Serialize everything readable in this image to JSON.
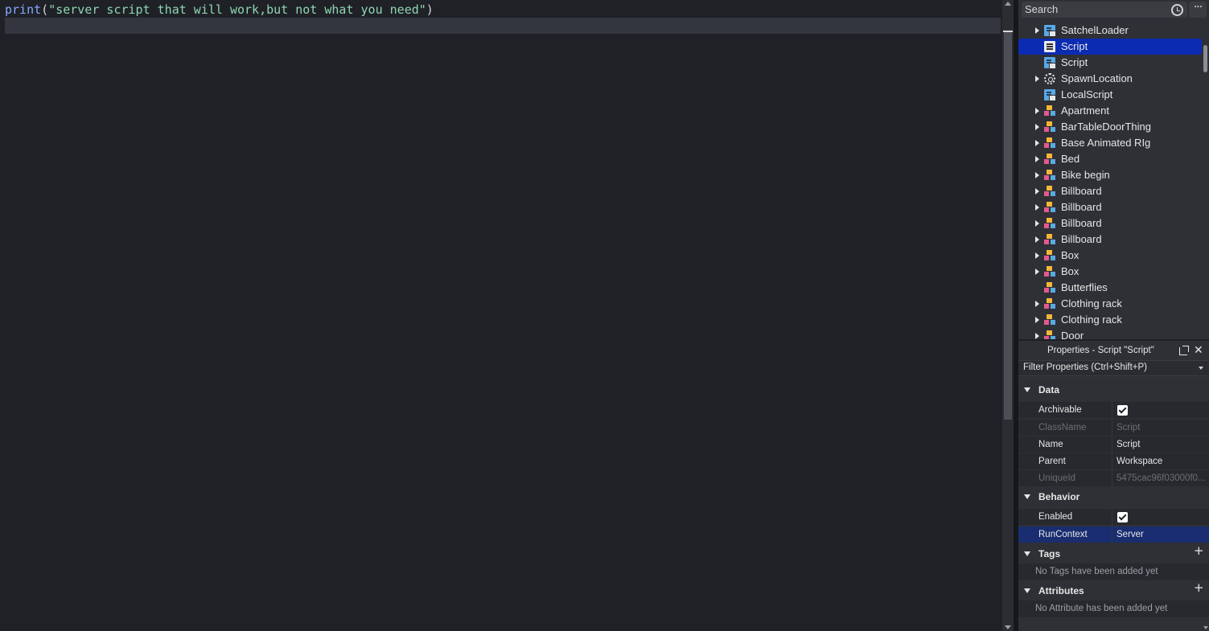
{
  "editor": {
    "line1": {
      "fn": "print",
      "open": "(",
      "string": "\"server script that will work,but not what you need\"",
      "close": ")"
    }
  },
  "explorer": {
    "search_placeholder": "Search",
    "more_label": "···",
    "items": [
      {
        "label": "SatchelLoader",
        "icon": "local-script-icon",
        "expandable": true,
        "selected": false
      },
      {
        "label": "Script",
        "icon": "script-icon",
        "expandable": false,
        "selected": true
      },
      {
        "label": "Script",
        "icon": "local-script-icon",
        "expandable": false,
        "selected": false
      },
      {
        "label": "SpawnLocation",
        "icon": "gear-icon",
        "expandable": true,
        "selected": false
      },
      {
        "label": "LocalScript",
        "icon": "local-script-icon",
        "expandable": false,
        "selected": false
      },
      {
        "label": "Apartment",
        "icon": "model-icon",
        "expandable": true,
        "selected": false
      },
      {
        "label": "BarTableDoorThing",
        "icon": "model-icon",
        "expandable": true,
        "selected": false
      },
      {
        "label": "Base Animated RIg",
        "icon": "model-icon",
        "expandable": true,
        "selected": false
      },
      {
        "label": "Bed",
        "icon": "model-icon",
        "expandable": true,
        "selected": false
      },
      {
        "label": "Bike begin",
        "icon": "model-icon",
        "expandable": true,
        "selected": false
      },
      {
        "label": "Billboard",
        "icon": "model-icon",
        "expandable": true,
        "selected": false
      },
      {
        "label": "Billboard",
        "icon": "model-icon",
        "expandable": true,
        "selected": false
      },
      {
        "label": "Billboard",
        "icon": "model-icon",
        "expandable": true,
        "selected": false
      },
      {
        "label": "Billboard",
        "icon": "model-icon",
        "expandable": true,
        "selected": false
      },
      {
        "label": "Box",
        "icon": "model-icon",
        "expandable": true,
        "selected": false
      },
      {
        "label": "Box",
        "icon": "model-icon",
        "expandable": true,
        "selected": false
      },
      {
        "label": "Butterflies",
        "icon": "model-icon",
        "expandable": false,
        "selected": false
      },
      {
        "label": "Clothing rack",
        "icon": "model-icon",
        "expandable": true,
        "selected": false
      },
      {
        "label": "Clothing rack",
        "icon": "model-icon",
        "expandable": true,
        "selected": false
      },
      {
        "label": "Door",
        "icon": "model-icon",
        "expandable": true,
        "selected": false
      }
    ]
  },
  "properties": {
    "title": "Properties - Script \"Script\"",
    "close_label": "✕",
    "filter_placeholder": "Filter Properties (Ctrl+Shift+P)",
    "data_section": "Data",
    "archivable": "Archivable",
    "classname": "ClassName",
    "classname_value": "Script",
    "name": "Name",
    "name_value": "Script",
    "parent": "Parent",
    "parent_value": "Workspace",
    "uniqueid": "UniqueId",
    "uniqueid_value": "5475cac96f03000f0...",
    "behavior_section": "Behavior",
    "enabled": "Enabled",
    "runcontext": "RunContext",
    "runcontext_value": "Server",
    "tags_section": "Tags",
    "tags_empty": "No Tags have been added yet",
    "attributes_section": "Attributes",
    "attributes_empty": "No Attribute has been added yet",
    "plus_label": "+"
  },
  "colors": {
    "selected": "#0c2bb3",
    "highlight_row": "#1a2d70",
    "editor_bg": "#1f2127",
    "string": "#8fd6b0",
    "function": "#87a9ff"
  }
}
